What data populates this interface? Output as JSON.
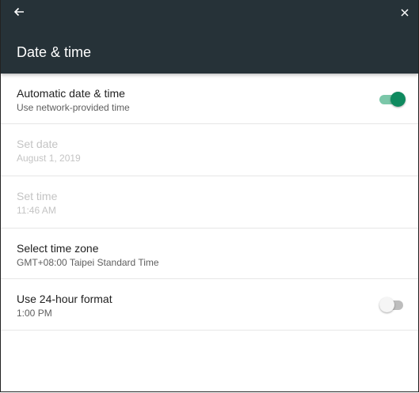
{
  "header": {
    "title": "Date & time",
    "back_icon": "arrow-left-icon",
    "close_icon": "close-icon"
  },
  "settings": [
    {
      "label": "Automatic date & time",
      "sub": "Use network-provided time",
      "toggle": "on",
      "enabled": true
    },
    {
      "label": "Set date",
      "sub": "August 1, 2019",
      "enabled": false
    },
    {
      "label": "Set time",
      "sub": "11:46 AM",
      "enabled": false
    },
    {
      "label": "Select time zone",
      "sub": "GMT+08:00 Taipei Standard Time",
      "enabled": true
    },
    {
      "label": "Use 24-hour format",
      "sub": "1:00 PM",
      "toggle": "off",
      "enabled": true
    }
  ],
  "colors": {
    "appbar": "#263238",
    "accent": "#0f8a5f"
  }
}
